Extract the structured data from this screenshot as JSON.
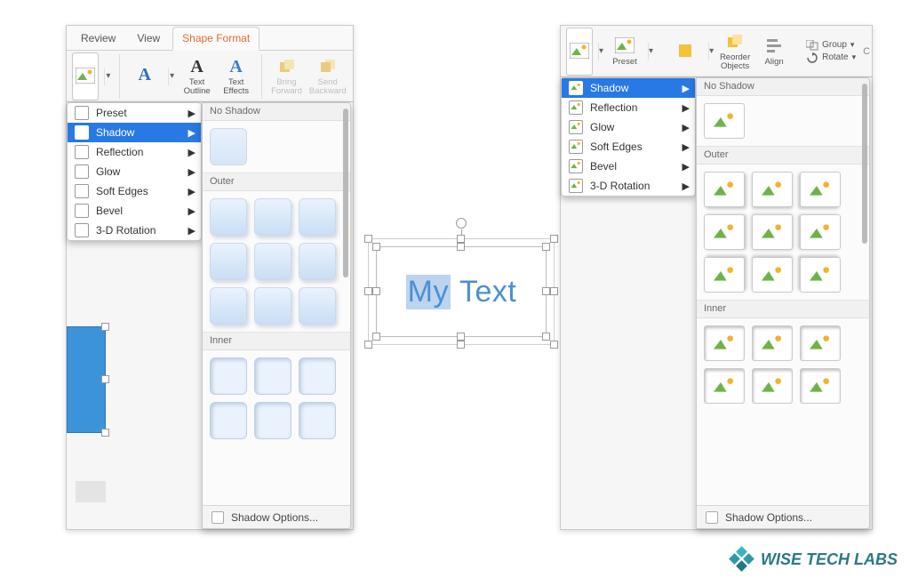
{
  "left": {
    "tabs": [
      "Review",
      "View",
      "Shape Format"
    ],
    "active_tab": "Shape Format",
    "ribbon": {
      "text_outline": "Text\nOutline",
      "text_effects": "Text\nEffects",
      "bring_forward": "Bring\nForward",
      "send_backward": "Send\nBackward"
    },
    "menu": [
      "Preset",
      "Shadow",
      "Reflection",
      "Glow",
      "Soft Edges",
      "Bevel",
      "3-D Rotation"
    ],
    "selected": "Shadow",
    "gallery": {
      "s1": "No Shadow",
      "s2": "Outer",
      "s3": "Inner",
      "options": "Shadow Options..."
    }
  },
  "right": {
    "ribbon": {
      "preset": "Preset",
      "reorder": "Reorder\nObjects",
      "align": "Align",
      "group": "Group",
      "rotate": "Rotate"
    },
    "menu": [
      "Shadow",
      "Reflection",
      "Glow",
      "Soft Edges",
      "Bevel",
      "3-D Rotation"
    ],
    "selected": "Shadow",
    "gallery": {
      "s1": "No Shadow",
      "s2": "Outer",
      "s3": "Inner",
      "options": "Shadow Options..."
    }
  },
  "textbox": {
    "part1": "My",
    "part2": "Text"
  },
  "brand": "WISE TECH LABS",
  "colors": {
    "accent_orange": "#e36a2d",
    "menu_highlight": "#2879e4",
    "textbox_text": "#4d8fd1",
    "blue_shape": "#3d93d9"
  }
}
